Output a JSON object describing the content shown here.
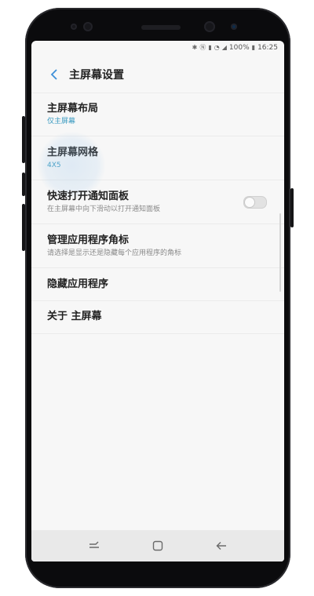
{
  "status_bar": {
    "icons": [
      "bluetooth-icon",
      "nfc-icon",
      "vibrate-icon",
      "wifi-icon",
      "signal-icon",
      "battery-icon"
    ],
    "battery": "100%",
    "time": "16:25"
  },
  "header": {
    "back_icon": "chevron-left-icon",
    "title": "主屏幕设置"
  },
  "settings": {
    "layout": {
      "title": "主屏幕布局",
      "subtitle": "仅主屏幕"
    },
    "grid": {
      "title": "主屏幕网格",
      "subtitle": "4X5"
    },
    "notification_panel": {
      "title": "快速打开通知面板",
      "subtitle": "在主屏幕中向下滑动以打开通知面板",
      "enabled": false
    },
    "app_badges": {
      "title": "管理应用程序角标",
      "subtitle": "请选择是显示还是隐藏每个应用程序的角标"
    },
    "hide_apps": {
      "title": "隐藏应用程序"
    },
    "about": {
      "title": "关于 主屏幕"
    }
  },
  "nav_bar": {
    "buttons": [
      "recents-icon",
      "home-icon",
      "back-icon"
    ]
  },
  "colors": {
    "accent": "#3a9ac0",
    "back_arrow": "#3d8fd8",
    "screen_bg": "#f7f7f7",
    "nav_bg": "#e9e9e9",
    "bezel": "#0b0b0d"
  }
}
